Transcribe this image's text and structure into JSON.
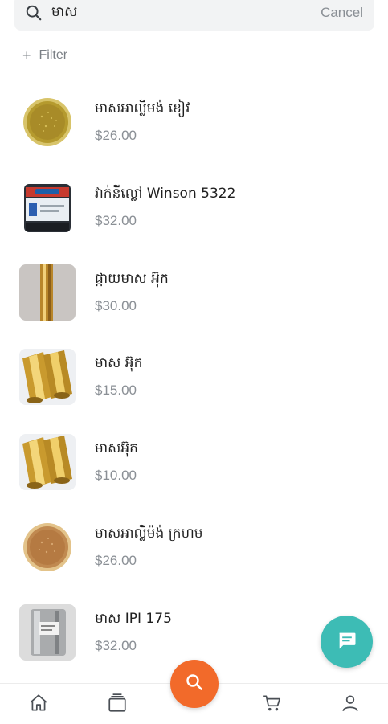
{
  "search": {
    "value": "មាស",
    "placeholder": "",
    "cancel_label": "Cancel",
    "icon": "search-icon"
  },
  "filter": {
    "label": "Filter",
    "icon": "plus-icon"
  },
  "products": [
    {
      "name": "មាសអាល្លីមង់ ខៀវ",
      "price": "$26.00",
      "image": "gold-glitter-jar"
    },
    {
      "name": "វាក់នីល្លៅ Winson 5322",
      "price": "$32.00",
      "image": "ink-can"
    },
    {
      "name": "ផ្កាយមាស អ៊ុក",
      "price": "$30.00",
      "image": "gold-foil-roll"
    },
    {
      "name": "មាស អ៊ុក",
      "price": "$15.00",
      "image": "gold-foil-rolls"
    },
    {
      "name": "មាសអ៊ុត",
      "price": "$10.00",
      "image": "gold-foil-rolls"
    },
    {
      "name": "មាសអាល្លីម៉ង់ ក្រហម",
      "price": "$26.00",
      "image": "bronze-powder-jar"
    },
    {
      "name": "មាស IPI 175",
      "price": "$32.00",
      "image": "silver-ink-can"
    }
  ],
  "chat_button": {
    "icon": "chat-icon",
    "color": "#3dbcb5"
  },
  "bottom_nav": {
    "items": [
      "home-icon",
      "categories-icon",
      "search-icon",
      "cart-icon",
      "account-icon"
    ],
    "active_color": "#f26a2a"
  }
}
